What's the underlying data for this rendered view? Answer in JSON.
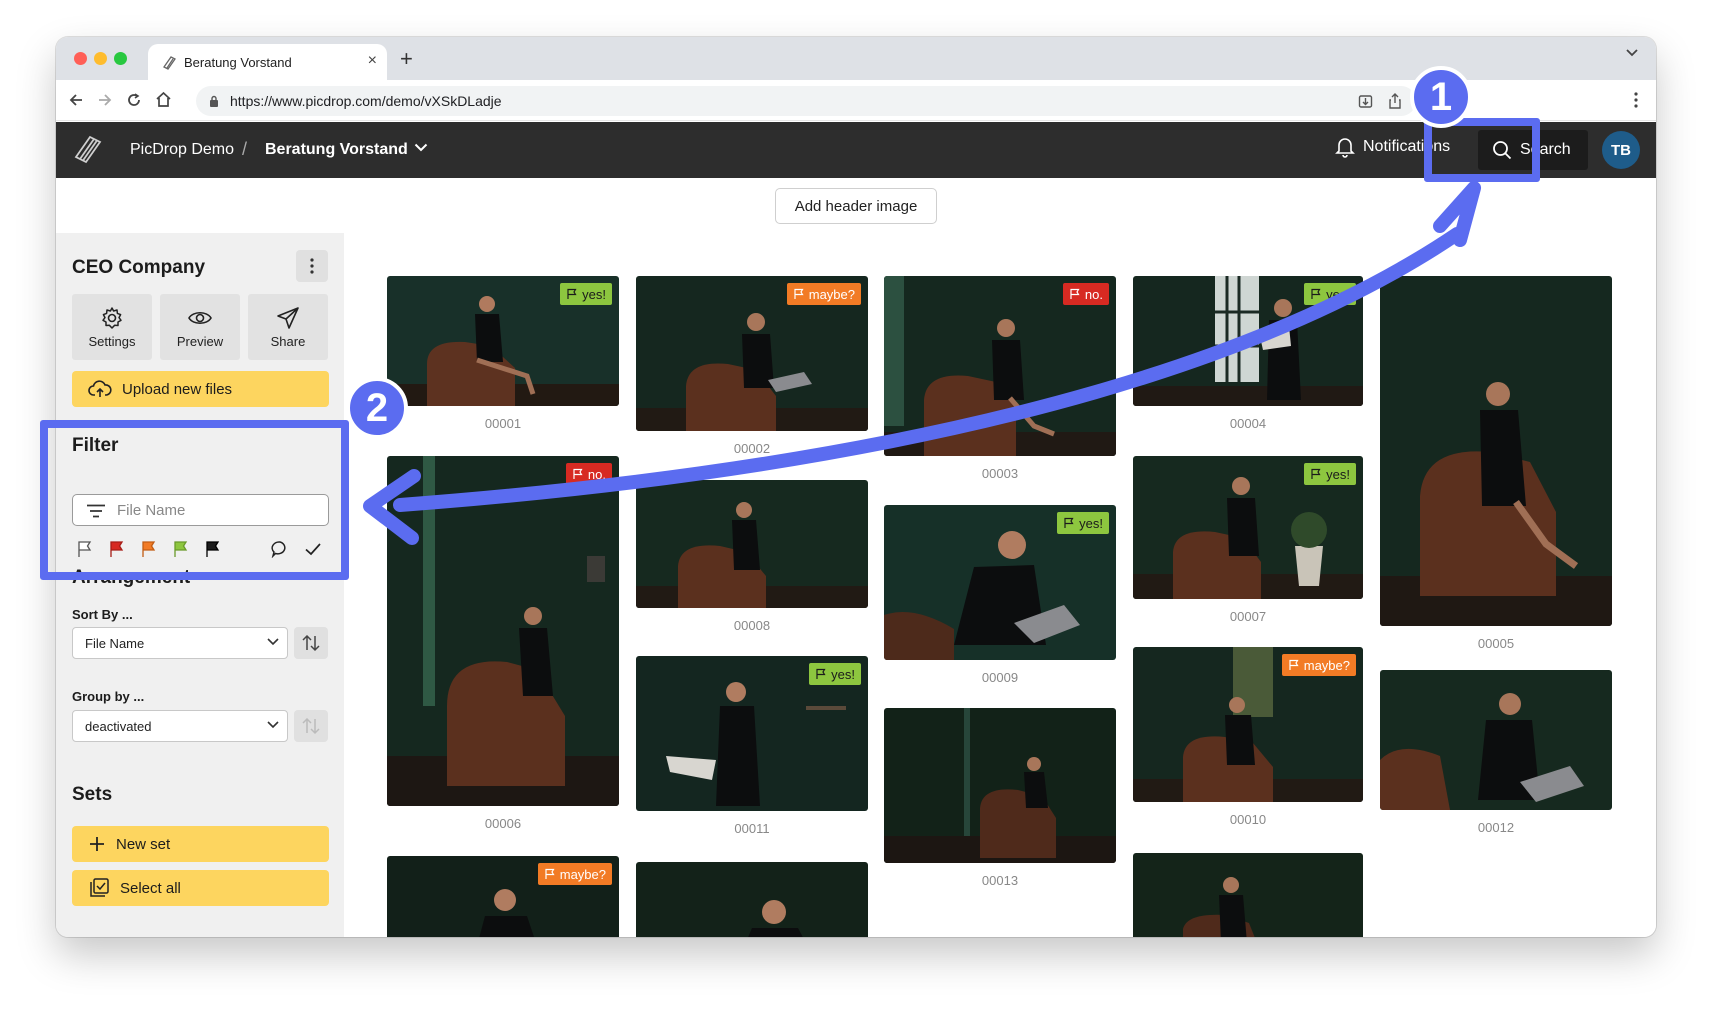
{
  "browser": {
    "tab_title": "Beratung Vorstand",
    "tab_close": "×",
    "new_tab": "+",
    "url": "https://www.picdrop.com/demo/vXSkDLadje"
  },
  "app": {
    "crumb_project": "PicDrop Demo",
    "crumb_separator": "/",
    "crumb_current": "Beratung Vorstand",
    "notifications_label": "Notifications",
    "search_label": "Search",
    "avatar_initials": "TB",
    "add_header_image": "Add header image"
  },
  "sidebar": {
    "company": "CEO Company",
    "tiles": [
      {
        "label": "Settings",
        "icon": "gear-icon"
      },
      {
        "label": "Preview",
        "icon": "eye-icon"
      },
      {
        "label": "Share",
        "icon": "send-icon"
      }
    ],
    "upload_label": "Upload new files",
    "filter_title": "Filter",
    "filter_placeholder": "File Name",
    "flags": [
      {
        "name": "all",
        "color": "#ffffff"
      },
      {
        "name": "no",
        "color": "#d72a22"
      },
      {
        "name": "maybe",
        "color": "#f27b25"
      },
      {
        "name": "yes",
        "color": "#8dc63f"
      },
      {
        "name": "black",
        "color": "#1c1c1c"
      }
    ],
    "arrangement_title": "Arrangement",
    "sort_label": "Sort By ...",
    "sort_value": "File Name",
    "group_label": "Group by ...",
    "group_value": "deactivated",
    "sets_title": "Sets",
    "new_set_label": "New set",
    "select_all_label": "Select all"
  },
  "photos": [
    {
      "id": "00001",
      "flag": "yes",
      "flag_label": "yes!"
    },
    {
      "id": "00002",
      "flag": "maybe",
      "flag_label": "maybe?"
    },
    {
      "id": "00003",
      "flag": "no",
      "flag_label": "no."
    },
    {
      "id": "00004",
      "flag": "yes",
      "flag_label": "yes!"
    },
    {
      "id": "00005",
      "flag": null,
      "flag_label": ""
    },
    {
      "id": "00006",
      "flag": "no",
      "flag_label": "no."
    },
    {
      "id": "00008",
      "flag": null,
      "flag_label": ""
    },
    {
      "id": "00009",
      "flag": "yes",
      "flag_label": "yes!"
    },
    {
      "id": "00007",
      "flag": "yes",
      "flag_label": "yes!"
    },
    {
      "id": "00011",
      "flag": "yes",
      "flag_label": "yes!"
    },
    {
      "id": "00013",
      "flag": null,
      "flag_label": ""
    },
    {
      "id": "00010",
      "flag": "maybe",
      "flag_label": "maybe?"
    },
    {
      "id": "00012",
      "flag": null,
      "flag_label": ""
    },
    {
      "id": "",
      "flag": "maybe",
      "flag_label": "maybe?"
    },
    {
      "id": "",
      "flag": null,
      "flag_label": ""
    },
    {
      "id": "",
      "flag": null,
      "flag_label": ""
    }
  ],
  "annotations": {
    "step1": "1",
    "step2": "2",
    "color": "#5b6cf0"
  },
  "colors": {
    "accent_yellow": "#fdd55f",
    "appbar": "#2d2d2d",
    "flag_yes": "#8dc63f",
    "flag_maybe": "#f27b25",
    "flag_no": "#d72a22"
  }
}
